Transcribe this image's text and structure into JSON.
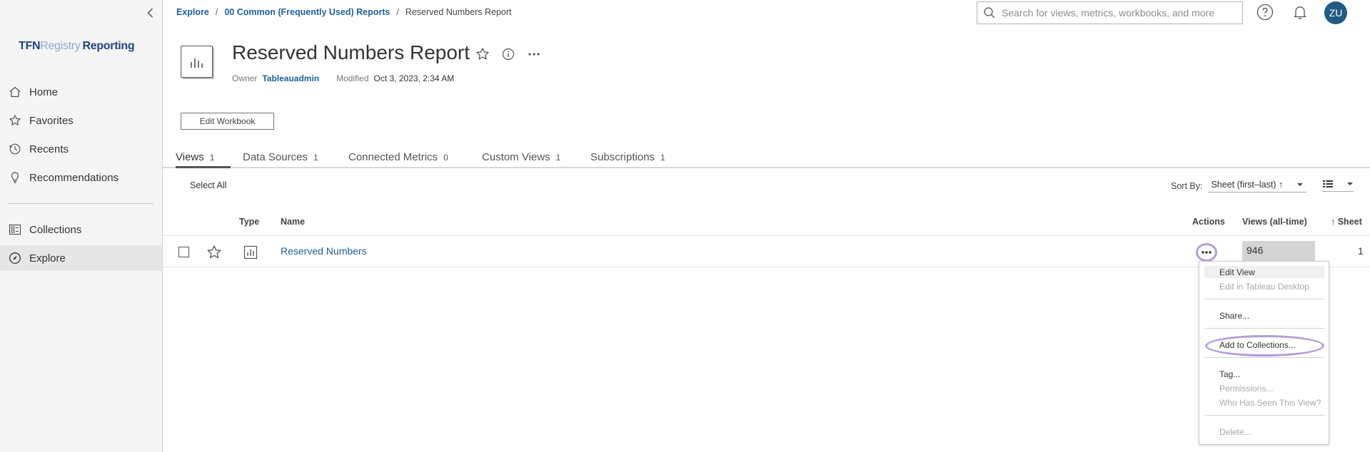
{
  "sidebar": {
    "logo": {
      "part1": "TFN",
      "part2": "Registry",
      "part3": "Reporting"
    },
    "items": [
      {
        "label": "Home",
        "icon": "home-icon"
      },
      {
        "label": "Favorites",
        "icon": "star-icon"
      },
      {
        "label": "Recents",
        "icon": "clock-icon"
      },
      {
        "label": "Recommendations",
        "icon": "lightbulb-icon"
      },
      {
        "label": "Collections",
        "icon": "collections-icon"
      },
      {
        "label": "Explore",
        "icon": "compass-icon",
        "active": true
      }
    ]
  },
  "breadcrumb": {
    "items": [
      "Explore",
      "00 Common (Frequently Used) Reports"
    ],
    "current": "Reserved Numbers Report"
  },
  "search": {
    "placeholder": "Search for views, metrics, workbooks, and more"
  },
  "user": {
    "initials": "ZU"
  },
  "workbook": {
    "title": "Reserved Numbers Report",
    "owner_label": "Owner",
    "owner": "Tableauadmin",
    "modified_label": "Modified",
    "modified": "Oct 3, 2023, 2:34 AM",
    "edit_button": "Edit Workbook"
  },
  "tabs": [
    {
      "label": "Views",
      "count": "1",
      "active": true
    },
    {
      "label": "Data Sources",
      "count": "1"
    },
    {
      "label": "Connected Metrics",
      "count": "0"
    },
    {
      "label": "Custom Views",
      "count": "1"
    },
    {
      "label": "Subscriptions",
      "count": "1"
    }
  ],
  "toolbar": {
    "select_all": "Select All",
    "sort_label": "Sort By:",
    "sort_value": "Sheet (first–last) ↑"
  },
  "table": {
    "headers": {
      "type": "Type",
      "name": "Name",
      "actions": "Actions",
      "views": "Views (all-time)",
      "sheet": "↑ Sheet"
    },
    "rows": [
      {
        "name": "Reserved Numbers",
        "views": "946",
        "sheet": "1"
      }
    ]
  },
  "menu": {
    "items": [
      {
        "label": "Edit View",
        "enabled": true
      },
      {
        "label": "Edit in Tableau Desktop",
        "enabled": false
      },
      {
        "label": "Share...",
        "enabled": true
      },
      {
        "label": "Add to Collections...",
        "enabled": true
      },
      {
        "label": "Tag...",
        "enabled": true
      },
      {
        "label": "Permissions...",
        "enabled": false
      },
      {
        "label": "Who Has Seen This View?",
        "enabled": false
      },
      {
        "label": "Delete...",
        "enabled": false
      }
    ]
  },
  "colors": {
    "link": "#1f5f9e",
    "avatar": "#1f5b82",
    "highlight_ring": "#b19cd9",
    "sidebar_bg": "#f5f5f5",
    "logo_primary": "#1f457e",
    "logo_secondary": "#8fa9c9"
  }
}
